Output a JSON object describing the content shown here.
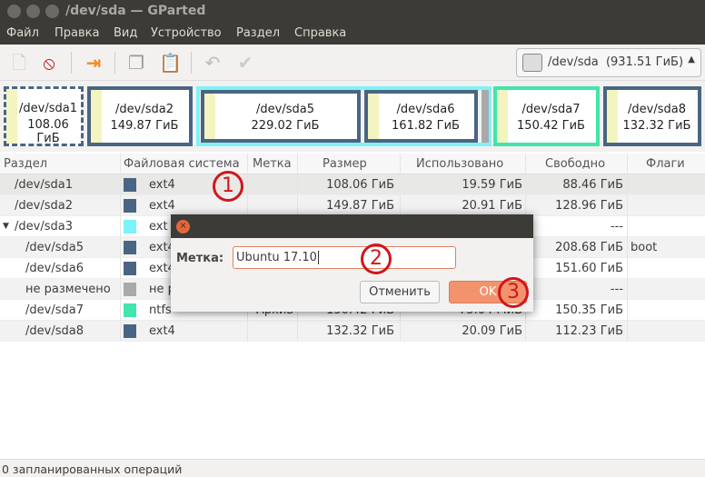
{
  "window": {
    "title": "/dev/sda — GParted"
  },
  "menu": [
    "Файл",
    "Правка",
    "Вид",
    "Устройство",
    "Раздел",
    "Справка"
  ],
  "toolbar": {
    "icons": [
      "new-partition-icon",
      "delete-icon",
      "resize-move-icon",
      "copy-icon",
      "paste-icon",
      "undo-icon",
      "apply-icon"
    ]
  },
  "device": {
    "name": "/dev/sda",
    "size": "(931.51 ГиБ)"
  },
  "map": [
    {
      "name": "/dev/sda1",
      "size": "108.06 ГиБ"
    },
    {
      "name": "/dev/sda2",
      "size": "149.87 ГиБ"
    },
    {
      "name": "/dev/sda5",
      "size": "229.02 ГиБ"
    },
    {
      "name": "/dev/sda6",
      "size": "161.82 ГиБ"
    },
    {
      "name": "/dev/sda7",
      "size": "150.42 ГиБ"
    },
    {
      "name": "/dev/sda8",
      "size": "132.32 ГиБ"
    }
  ],
  "columns": [
    "Раздел",
    "Файловая система",
    "Метка",
    "Размер",
    "Использовано",
    "Свободно",
    "Флаги"
  ],
  "colors": {
    "ext4": "#4a6583",
    "extended": "#7df3f8",
    "unallocated": "#a9a9a9",
    "ntfs": "#42e5ac"
  },
  "rows": [
    {
      "part": "/dev/sda1",
      "fs": "ext4",
      "label": "",
      "size": "108.06 ГиБ",
      "used": "19.59 ГиБ",
      "free": "88.46 ГиБ",
      "flags": "",
      "color": "#4a6583"
    },
    {
      "part": "/dev/sda2",
      "fs": "ext4",
      "label": "",
      "size": "149.87 ГиБ",
      "used": "20.91 ГиБ",
      "free": "128.96 ГиБ",
      "flags": "",
      "color": "#4a6583"
    },
    {
      "part": "/dev/sda3",
      "fs": "ext",
      "label": "",
      "size": "",
      "used": "",
      "free": "---",
      "flags": "",
      "color": "#7df3f8"
    },
    {
      "part": "/dev/sda5",
      "fs": "ext4",
      "label": "",
      "size": "",
      "used": "",
      "free": "208.68 ГиБ",
      "flags": "boot",
      "color": "#4a6583"
    },
    {
      "part": "/dev/sda6",
      "fs": "ext4",
      "label": "",
      "size": "",
      "used": "",
      "free": "151.60 ГиБ",
      "flags": "",
      "color": "#4a6583"
    },
    {
      "part": "не размечено",
      "fs": "не р",
      "label": "",
      "size": "",
      "used": "",
      "free": "---",
      "flags": "",
      "color": "#a9a9a9"
    },
    {
      "part": "/dev/sda7",
      "fs": "ntfs",
      "label": "Архив",
      "size": "150.42 ГиБ",
      "used": "75.04 МиБ",
      "free": "150.35 ГиБ",
      "flags": "",
      "color": "#42e5ac"
    },
    {
      "part": "/dev/sda8",
      "fs": "ext4",
      "label": "",
      "size": "132.32 ГиБ",
      "used": "20.09 ГиБ",
      "free": "112.23 ГиБ",
      "flags": "",
      "color": "#4a6583"
    }
  ],
  "status": "0 запланированных операций",
  "dialog": {
    "label": "Метка:",
    "value": "Ubuntu 17.10",
    "cancel": "Отменить",
    "ok": "OK",
    "close": "×"
  },
  "annotations": [
    "1",
    "2",
    "3"
  ]
}
